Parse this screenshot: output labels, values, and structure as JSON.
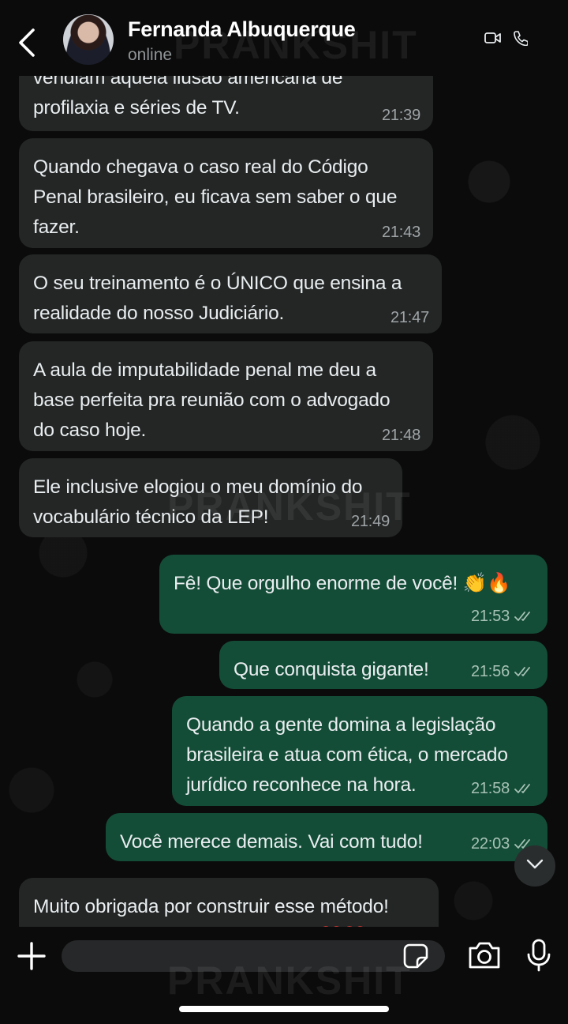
{
  "header": {
    "contact_name": "Fernanda Albuquerque",
    "status": "online"
  },
  "watermark": "PRANKSHIT",
  "messages": [
    {
      "direction": "incoming",
      "text": "vendiam aquela ilusão americana de\nprofilaxia e séries de TV.",
      "time": "21:39"
    },
    {
      "direction": "incoming",
      "text": "Quando chegava o caso real do Código\nPenal brasileiro, eu ficava sem saber o que\nfazer.",
      "time": "21:43"
    },
    {
      "direction": "incoming",
      "text": "O seu treinamento é o ÚNICO que ensina a\nrealidade do nosso Judiciário.",
      "time": "21:47"
    },
    {
      "direction": "incoming",
      "text": "A aula de imputabilidade penal me deu a\nbase perfeita pra reunião com o advogado\ndo caso hoje.",
      "time": "21:48"
    },
    {
      "direction": "incoming",
      "text": "Ele inclusive elogiou o meu domínio do\nvocabulário técnico da LEP!",
      "time": "21:49"
    },
    {
      "direction": "outgoing",
      "text": "Fê! Que orgulho enorme de você! 👏🔥",
      "time": "21:53"
    },
    {
      "direction": "outgoing",
      "text": "Que conquista gigante!",
      "time": "21:56"
    },
    {
      "direction": "outgoing",
      "text": "Quando a gente domina a legislação\nbrasileira e atua com ética, o mercado\njurídico reconhece na hora.",
      "time": "21:58"
    },
    {
      "direction": "outgoing",
      "text": "Você merece demais. Vai com tudo!",
      "time": "22:03"
    },
    {
      "direction": "incoming",
      "text": "Muito obrigada por construir esse método!\nMudou o rumo da minha carreira! ❤️❤️",
      "time": ""
    }
  ],
  "composer": {
    "placeholder": ""
  },
  "icons": {
    "back": "chevron-left-icon",
    "video": "video-call-icon",
    "phone": "phone-icon",
    "attach": "plus-icon",
    "sticker": "sticker-icon",
    "camera": "camera-icon",
    "mic": "microphone-icon",
    "scroll": "chevron-down-icon",
    "read": "double-check-icon"
  },
  "colors": {
    "incoming_bubble": "#242626",
    "outgoing_bubble": "#144d37",
    "background": "#0b0b0b"
  }
}
